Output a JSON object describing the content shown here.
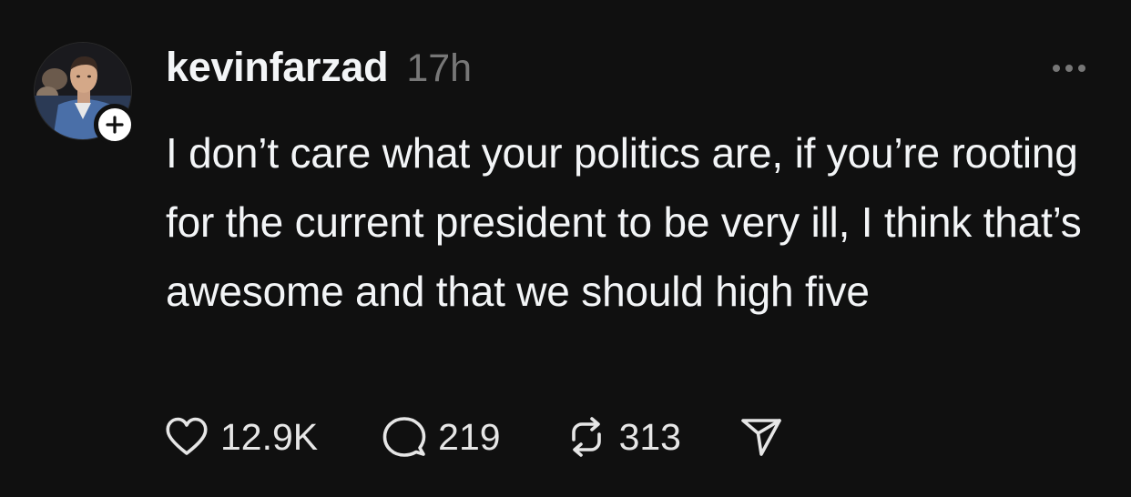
{
  "post": {
    "username": "kevinfarzad",
    "timestamp": "17h",
    "text": "I don’t care what your politics are, if you’re rooting for the current president to be very ill, I think that’s awesome and that we should high five",
    "likes": "12.9K",
    "replies": "219",
    "reposts": "313"
  },
  "icons": {
    "follow": "plus-icon",
    "more": "ellipsis-icon",
    "like": "heart-icon",
    "reply": "speech-bubble-icon",
    "repost": "repost-arrows-icon",
    "share": "paper-plane-icon"
  },
  "colors": {
    "background": "#101010",
    "text": "#f3f5f7",
    "muted": "#777777",
    "icon": "#e6e6e6"
  }
}
